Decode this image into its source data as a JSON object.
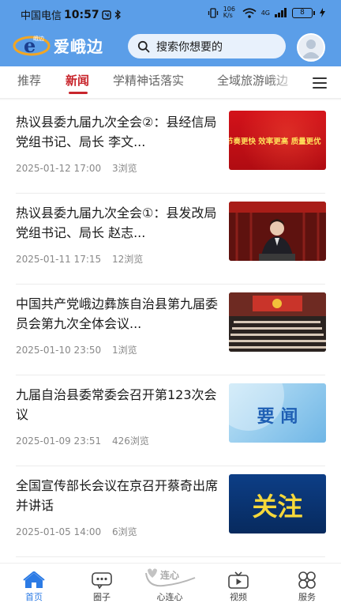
{
  "status_bar": {
    "carrier": "中国电信",
    "time": "10:57",
    "network_speed": "106 K/s",
    "signal_type": "4G",
    "battery": "8"
  },
  "header": {
    "app_name": "爱峨边",
    "logo_small_text": "峨边",
    "search_placeholder": "搜索你想要的"
  },
  "tabs": [
    {
      "label": "推荐",
      "active": false
    },
    {
      "label": "新闻",
      "active": true
    },
    {
      "label": "学精神话落实",
      "active": false
    },
    {
      "label": "全域旅游峨边",
      "active": false
    }
  ],
  "news": [
    {
      "title": "热议县委九届九次全会②：县经信局党组书记、局长 李文...",
      "date": "2025-01-12 17:00",
      "views": "3浏览",
      "thumb_text": "节奏更快 效率更高 质量更优",
      "thumb_type": "red-banner"
    },
    {
      "title": "热议县委九届九次全会①：县发改局党组书记、局长 赵志...",
      "date": "2025-01-11 17:15",
      "views": "12浏览",
      "thumb_text": "",
      "thumb_type": "speaker"
    },
    {
      "title": "中国共产党峨边彝族自治县第九届委员会第九次全体会议...",
      "date": "2025-01-10 23:50",
      "views": "1浏览",
      "thumb_text": "",
      "thumb_type": "hall"
    },
    {
      "title": "九届自治县委常委会召开第123次会议",
      "date": "2025-01-09 23:51",
      "views": "426浏览",
      "thumb_text": "要 闻",
      "thumb_type": "blue-label"
    },
    {
      "title": "全国宣传部长会议在京召开蔡奇出席并讲话",
      "date": "2025-01-05 14:00",
      "views": "6浏览",
      "thumb_text": "关注",
      "thumb_type": "focus"
    }
  ],
  "bottom_nav": [
    {
      "label": "首页",
      "icon": "home-icon",
      "active": true
    },
    {
      "label": "圈子",
      "icon": "chat-icon",
      "active": false
    },
    {
      "label": "心连心",
      "icon": "heart-link-icon",
      "active": false,
      "badge_text": "连心"
    },
    {
      "label": "视频",
      "icon": "video-icon",
      "active": false
    },
    {
      "label": "服务",
      "icon": "service-icon",
      "active": false
    }
  ],
  "colors": {
    "header_bg": "#5b9ee8",
    "accent_red": "#c8252c",
    "nav_active": "#2c7be5"
  }
}
